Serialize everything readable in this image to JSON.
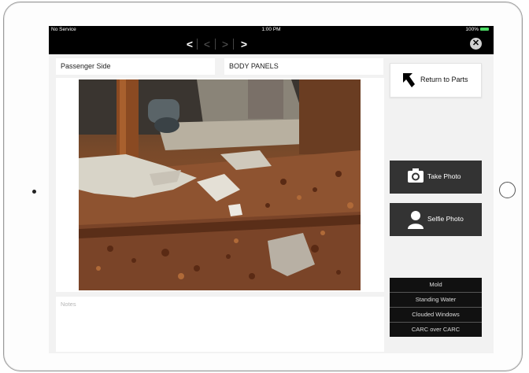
{
  "status_bar": {
    "carrier": "No Service",
    "time": "1:00 PM",
    "battery": "100%"
  },
  "nav": {
    "prev_arrow": "<",
    "prev_dim_arrow": "<",
    "next_dim_arrow": ">",
    "next_arrow": ">",
    "close_icon": "close-icon"
  },
  "fields": {
    "side": "Passenger Side",
    "category": "BODY PANELS"
  },
  "notes": {
    "placeholder": "Notes"
  },
  "actions": {
    "return_label": "Return to Parts",
    "take_photo_label": "Take Photo",
    "selfie_photo_label": "Selfie Photo"
  },
  "conditions": [
    "Mold",
    "Standing Water",
    "Clouded Windows",
    "CARC over CARC"
  ],
  "colors": {
    "dark_button": "#333333",
    "conditions_bg": "#111111",
    "nav_bg": "#000000"
  }
}
